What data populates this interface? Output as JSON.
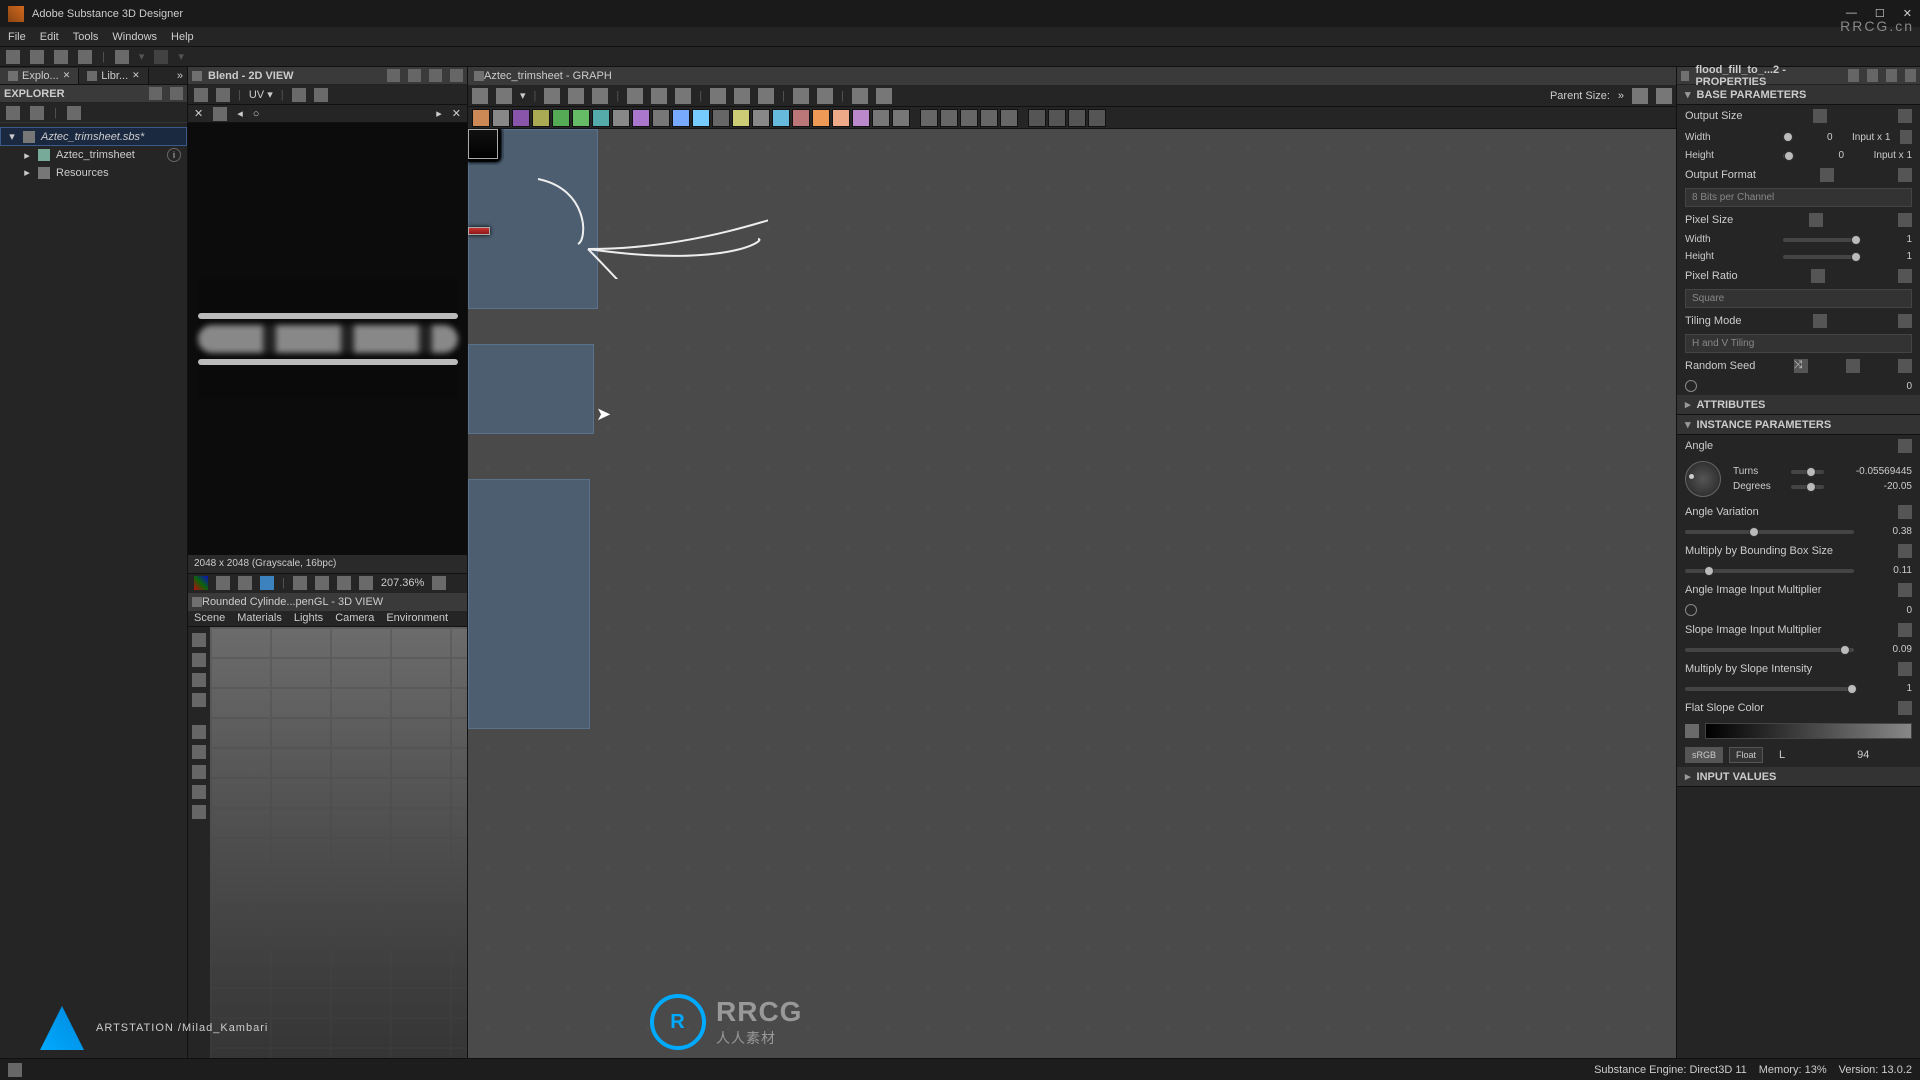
{
  "app": {
    "title": "Adobe Substance 3D Designer"
  },
  "menubar": [
    "File",
    "Edit",
    "Tools",
    "Windows",
    "Help"
  ],
  "left": {
    "tab_explo": "Explo...",
    "tab_libr": "Libr...",
    "panel_title": "EXPLORER",
    "file": "Aztec_trimsheet.sbs*",
    "child1": "Aztec_trimsheet",
    "child2": "Resources"
  },
  "view2d": {
    "title": "Blend - 2D VIEW",
    "status": "2048 x 2048 (Grayscale, 16bpc)",
    "zoom": "207.36%",
    "uv_label": "UV"
  },
  "view3d": {
    "title": "Rounded Cylinde...penGL - 3D VIEW",
    "menus": [
      "Scene",
      "Materials",
      "Lights",
      "Camera",
      "Environment"
    ]
  },
  "graph": {
    "title": "Aztec_trimsheet - GRAPH",
    "parentsize_lbl": "Parent Size:"
  },
  "props": {
    "title": "flood_fill_to_...2 - PROPERTIES",
    "base_params": "BASE PARAMETERS",
    "output_size": "Output Size",
    "width": "Width",
    "height": "Height",
    "width_val": "0",
    "height_val": "0",
    "input_x1": "Input x 1",
    "output_format": "Output Format",
    "format_val": "8 Bits per Channel",
    "pixel_size": "Pixel Size",
    "ps_width_val": "1",
    "ps_height_val": "1",
    "pixel_ratio": "Pixel Ratio",
    "ratio_val": "Square",
    "tiling": "Tiling Mode",
    "tiling_val": "H and V Tiling",
    "seed": "Random Seed",
    "seed_val": "0",
    "attributes": "ATTRIBUTES",
    "instance_params": "INSTANCE PARAMETERS",
    "angle": "Angle",
    "turns": "Turns",
    "turns_val": "-0.05569445",
    "degrees": "Degrees",
    "degrees_val": "-20.05",
    "angle_var": "Angle Variation",
    "angle_var_val": "0.38",
    "mult_bbox": "Multiply by Bounding Box Size",
    "mult_bbox_val": "0.11",
    "angle_img": "Angle Image Input Multiplier",
    "angle_img_val": "0",
    "slope_img": "Slope Image Input Multiplier",
    "slope_img_val": "0.09",
    "mult_slope": "Multiply by Slope Intensity",
    "mult_slope_val": "1",
    "flat_slope": "Flat Slope Color",
    "srgb": "sRGB",
    "float": "Float",
    "L": "L",
    "L_val": "94",
    "input_values": "INPUT VALUES"
  },
  "status": {
    "engine": "Substance Engine: Direct3D 11",
    "memory": "Memory: 13%",
    "version": "Version: 13.0.2"
  },
  "overlay": {
    "artstation": "ARTSTATION /Milad_Kambari",
    "rrcg_big": "RRCG",
    "rrcg_sub": "人人素材",
    "rrcg_corner": "RRCG.cn"
  }
}
